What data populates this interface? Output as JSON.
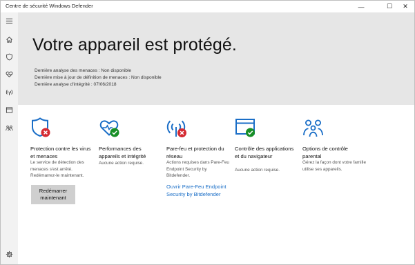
{
  "window": {
    "title": "Centre de sécurité Windows Defender",
    "controls": {
      "minimize": "—",
      "maximize": "☐",
      "close": "✕"
    }
  },
  "sidebar": {
    "items": [
      {
        "icon": "hamburger-menu-icon"
      },
      {
        "icon": "home-icon"
      },
      {
        "icon": "shield-icon"
      },
      {
        "icon": "heart-icon"
      },
      {
        "icon": "wireless-icon"
      },
      {
        "icon": "app-browser-icon"
      },
      {
        "icon": "family-icon"
      },
      {
        "icon": "gear-icon"
      }
    ]
  },
  "hero": {
    "heading": "Votre appareil est protégé.",
    "lines": [
      "Dernière analyse des menaces : Non disponible",
      "Dernière mise à jour de définition de menaces : Non disponible",
      "Dernière analyse d'intégrité : 07/06/2018"
    ]
  },
  "cards": [
    {
      "icon": "shield-error-icon",
      "title": "Protection contre les virus et menaces",
      "desc": "Le service de détection des menaces s'est arrêté. Redémarrez-le maintenant.",
      "button": "Redémarrer maintenant",
      "status": "error"
    },
    {
      "icon": "heart-ok-icon",
      "title": "Performances des appareils et intégrité",
      "desc": "Aucune action requise.",
      "status": "ok"
    },
    {
      "icon": "wireless-error-icon",
      "title": "Pare-feu et protection du réseau",
      "desc": "Actions requises dans Pare-Feu Endpoint Security by Bitdefender.",
      "link": "Ouvrir Pare-Feu Endpoint Security by Bitdefender",
      "status": "error"
    },
    {
      "icon": "browser-ok-icon",
      "title": "Contrôle des applications et du navigateur",
      "desc": "Aucune action requise.",
      "status": "ok"
    },
    {
      "icon": "family-icon",
      "title": "Options de contrôle parental",
      "desc": "Gérez la façon dont votre famille utilise ses appareils.",
      "status": "none"
    }
  ],
  "colors": {
    "accent": "#1a6ec7",
    "error": "#d52a32",
    "ok": "#188f26",
    "hero_bg": "#e6e6e6",
    "sidebar_bg": "#f2f2f2"
  }
}
